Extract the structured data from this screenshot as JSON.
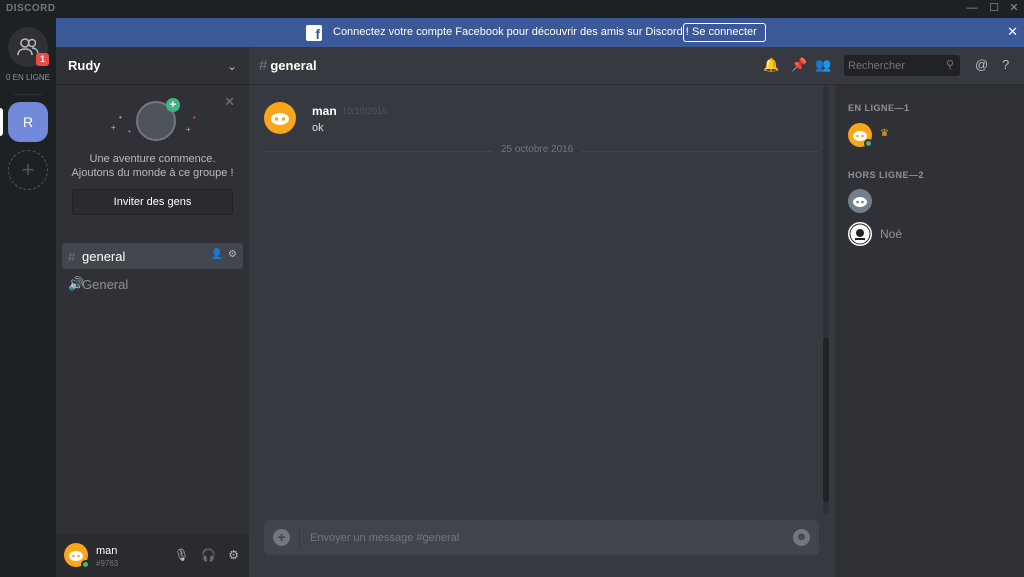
{
  "window": {
    "brand": "DISCORD",
    "controls": {
      "minimize": "—",
      "maximize": "☐",
      "close": "✕"
    }
  },
  "guilds": {
    "friends_badge": "1",
    "online_label": "0 EN LIGNE",
    "server_initial": "R",
    "add_symbol": "+"
  },
  "banner": {
    "text": "Connectez votre compte Facebook pour découvrir des amis sur Discord !",
    "button": "Se connecter",
    "close": "✕",
    "color": "#3b5998"
  },
  "server": {
    "name": "Rudy",
    "welcome_line1": "Une aventure commence.",
    "welcome_line2": "Ajoutons du monde à ce groupe !",
    "invite_button": "Inviter des gens",
    "channels": [
      {
        "name": "general",
        "type": "text",
        "active": true
      },
      {
        "name": "General",
        "type": "voice",
        "active": false
      }
    ]
  },
  "user_panel": {
    "username": "man",
    "discriminator": "#9763",
    "status_color": "#43b581"
  },
  "channel_header": {
    "hash": "#",
    "name": "general"
  },
  "toolbar": {
    "search_placeholder": "Rechercher",
    "icons": [
      "bell-icon",
      "pin-icon",
      "members-icon",
      "search-icon",
      "mention-icon",
      "help-icon"
    ]
  },
  "messages": [
    {
      "author": "man",
      "timestamp": "10/10/2016",
      "text": "ok"
    }
  ],
  "date_divider": "25 octobre 2016",
  "composer": {
    "placeholder": "Envoyer un message #general"
  },
  "members": {
    "online_header": "EN LIGNE—1",
    "offline_header": "HORS LIGNE—2",
    "online": [
      {
        "name": "",
        "owner": true
      }
    ],
    "offline": [
      {
        "name": ""
      },
      {
        "name": "Noé"
      }
    ]
  },
  "colors": {
    "accent": "#7289da",
    "online": "#43b581",
    "badge": "#f04747",
    "avatar_orange": "#faa61a"
  }
}
